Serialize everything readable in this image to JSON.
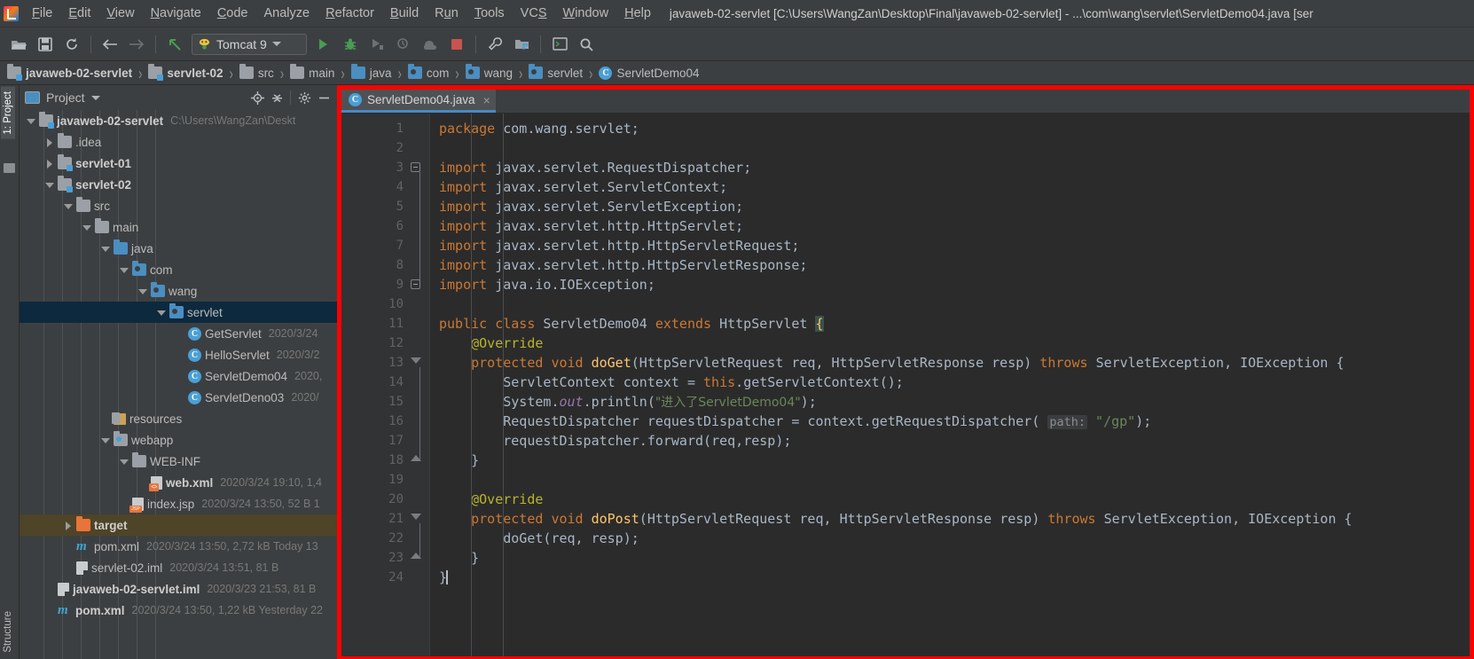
{
  "window": {
    "title": "javaweb-02-servlet [C:\\Users\\WangZan\\Desktop\\Final\\javaweb-02-servlet] - ...\\com\\wang\\servlet\\ServletDemo04.java [ser"
  },
  "menubar": {
    "items": [
      {
        "label": "File",
        "mnemonic": "F"
      },
      {
        "label": "Edit",
        "mnemonic": "E"
      },
      {
        "label": "View",
        "mnemonic": "V"
      },
      {
        "label": "Navigate",
        "mnemonic": "N"
      },
      {
        "label": "Code",
        "mnemonic": "C"
      },
      {
        "label": "Analyze",
        "mnemonic": ""
      },
      {
        "label": "Refactor",
        "mnemonic": "R"
      },
      {
        "label": "Build",
        "mnemonic": "B"
      },
      {
        "label": "Run",
        "mnemonic": "u"
      },
      {
        "label": "Tools",
        "mnemonic": "T"
      },
      {
        "label": "VCS",
        "mnemonic": "S"
      },
      {
        "label": "Window",
        "mnemonic": "W"
      },
      {
        "label": "Help",
        "mnemonic": "H"
      }
    ]
  },
  "toolbar": {
    "run_config": "Tomcat 9",
    "buttons": [
      "open-project-icon",
      "save-all-icon",
      "sync-icon",
      "back-icon",
      "forward-icon",
      "undo-icon",
      "run-icon",
      "debug-icon",
      "run-with-coverage-icon",
      "profile-icon",
      "update-app-icon",
      "stop-icon",
      "settings-wrench-icon",
      "project-structure-icon",
      "terminal-icon",
      "search-everywhere-icon"
    ]
  },
  "breadcrumb": {
    "items": [
      {
        "label": "javaweb-02-servlet",
        "icon": "module-folder-icon",
        "bold": true
      },
      {
        "label": "servlet-02",
        "icon": "module-folder-icon",
        "bold": true
      },
      {
        "label": "src",
        "icon": "folder-icon",
        "bold": false
      },
      {
        "label": "main",
        "icon": "folder-icon",
        "bold": false
      },
      {
        "label": "java",
        "icon": "source-folder-icon",
        "bold": false
      },
      {
        "label": "com",
        "icon": "package-icon",
        "bold": false
      },
      {
        "label": "wang",
        "icon": "package-icon",
        "bold": false
      },
      {
        "label": "servlet",
        "icon": "package-icon",
        "bold": false
      },
      {
        "label": "ServletDemo04",
        "icon": "class-icon",
        "bold": false
      }
    ]
  },
  "tool_windows": {
    "left_top": "1: Project",
    "left_bottom": "Structure"
  },
  "project_panel": {
    "title": "Project",
    "actions": [
      "locate-icon",
      "collapse-all-icon",
      "settings-gear-icon",
      "hide-icon"
    ],
    "tree": [
      {
        "depth": 0,
        "twist": "down",
        "icon": "module-folder-icon",
        "label": "javaweb-02-servlet",
        "bold": true,
        "meta": "C:\\Users\\WangZan\\Deskt"
      },
      {
        "depth": 1,
        "twist": "right",
        "icon": "folder-icon",
        "label": ".idea",
        "bold": false,
        "meta": ""
      },
      {
        "depth": 1,
        "twist": "right",
        "icon": "module-folder-icon",
        "label": "servlet-01",
        "bold": true,
        "meta": ""
      },
      {
        "depth": 1,
        "twist": "down",
        "icon": "module-folder-icon",
        "label": "servlet-02",
        "bold": true,
        "meta": ""
      },
      {
        "depth": 2,
        "twist": "down",
        "icon": "folder-icon",
        "label": "src",
        "bold": false,
        "meta": ""
      },
      {
        "depth": 3,
        "twist": "down",
        "icon": "folder-icon",
        "label": "main",
        "bold": false,
        "meta": ""
      },
      {
        "depth": 4,
        "twist": "down",
        "icon": "source-folder-icon",
        "label": "java",
        "bold": false,
        "meta": ""
      },
      {
        "depth": 5,
        "twist": "down",
        "icon": "package-icon",
        "label": "com",
        "bold": false,
        "meta": ""
      },
      {
        "depth": 6,
        "twist": "down",
        "icon": "package-icon",
        "label": "wang",
        "bold": false,
        "meta": ""
      },
      {
        "depth": 7,
        "twist": "down",
        "icon": "package-icon",
        "label": "servlet",
        "bold": false,
        "meta": "",
        "selected": true
      },
      {
        "depth": 8,
        "twist": "none",
        "icon": "class-icon",
        "label": "GetServlet",
        "bold": false,
        "meta": "2020/3/24"
      },
      {
        "depth": 8,
        "twist": "none",
        "icon": "class-icon",
        "label": "HelloServlet",
        "bold": false,
        "meta": "2020/3/2"
      },
      {
        "depth": 8,
        "twist": "none",
        "icon": "class-icon",
        "label": "ServletDemo04",
        "bold": false,
        "meta": "2020,"
      },
      {
        "depth": 8,
        "twist": "none",
        "icon": "class-icon",
        "label": "ServletDeno03",
        "bold": false,
        "meta": "2020/"
      },
      {
        "depth": 4,
        "twist": "none",
        "icon": "resources-icon",
        "label": "resources",
        "bold": false,
        "meta": ""
      },
      {
        "depth": 4,
        "twist": "down",
        "icon": "webapp-icon",
        "label": "webapp",
        "bold": false,
        "meta": ""
      },
      {
        "depth": 5,
        "twist": "down",
        "icon": "folder-icon",
        "label": "WEB-INF",
        "bold": false,
        "meta": ""
      },
      {
        "depth": 6,
        "twist": "none",
        "icon": "xml-file-icon",
        "label": "web.xml",
        "bold": true,
        "meta": "2020/3/24 19:10, 1,4"
      },
      {
        "depth": 5,
        "twist": "none",
        "icon": "jsp-file-icon",
        "label": "index.jsp",
        "bold": false,
        "meta": "2020/3/24 13:50, 52 B 1"
      },
      {
        "depth": 2,
        "twist": "right",
        "icon": "target-folder-icon",
        "label": "target",
        "bold": true,
        "meta": "",
        "highlight": true
      },
      {
        "depth": 2,
        "twist": "none",
        "icon": "maven-icon",
        "label": "pom.xml",
        "bold": false,
        "meta": "2020/3/24 13:50, 2,72 kB Today 13"
      },
      {
        "depth": 2,
        "twist": "none",
        "icon": "iml-file-icon",
        "label": "servlet-02.iml",
        "bold": false,
        "meta": "2020/3/24 13:51, 81 B"
      },
      {
        "depth": 1,
        "twist": "none",
        "icon": "iml-file-icon",
        "label": "javaweb-02-servlet.iml",
        "bold": true,
        "meta": "2020/3/23 21:53, 81 B"
      },
      {
        "depth": 1,
        "twist": "none",
        "icon": "maven-icon",
        "label": "pom.xml",
        "bold": true,
        "meta": "2020/3/24 13:50, 1,22 kB Yesterday 22"
      }
    ]
  },
  "editor": {
    "tab": {
      "label": "ServletDemo04.java",
      "icon": "java-class-icon",
      "close": "×"
    },
    "gutter_markers": [
      {
        "line": 13,
        "icon": "overriding-method-icon"
      },
      {
        "line": 21,
        "icon": "overriding-method-icon"
      }
    ],
    "lines": [
      {
        "n": 1,
        "text": "package com.wang.servlet;"
      },
      {
        "n": 2,
        "text": ""
      },
      {
        "n": 3,
        "text": "import javax.servlet.RequestDispatcher;"
      },
      {
        "n": 4,
        "text": "import javax.servlet.ServletContext;"
      },
      {
        "n": 5,
        "text": "import javax.servlet.ServletException;"
      },
      {
        "n": 6,
        "text": "import javax.servlet.http.HttpServlet;"
      },
      {
        "n": 7,
        "text": "import javax.servlet.http.HttpServletRequest;"
      },
      {
        "n": 8,
        "text": "import javax.servlet.http.HttpServletResponse;"
      },
      {
        "n": 9,
        "text": "import java.io.IOException;"
      },
      {
        "n": 10,
        "text": ""
      },
      {
        "n": 11,
        "text": "public class ServletDemo04 extends HttpServlet {"
      },
      {
        "n": 12,
        "text": "    @Override"
      },
      {
        "n": 13,
        "text": "    protected void doGet(HttpServletRequest req, HttpServletResponse resp) throws ServletException, IOException {"
      },
      {
        "n": 14,
        "text": "        ServletContext context = this.getServletContext();"
      },
      {
        "n": 15,
        "text": "        System.out.println(\"进入了ServletDemo04\");"
      },
      {
        "n": 16,
        "text": "        RequestDispatcher requestDispatcher = context.getRequestDispatcher( path: \"/gp\");"
      },
      {
        "n": 17,
        "text": "        requestDispatcher.forward(req,resp);"
      },
      {
        "n": 18,
        "text": "    }"
      },
      {
        "n": 19,
        "text": ""
      },
      {
        "n": 20,
        "text": "    @Override"
      },
      {
        "n": 21,
        "text": "    protected void doPost(HttpServletRequest req, HttpServletResponse resp) throws ServletException, IOException {"
      },
      {
        "n": 22,
        "text": "        doGet(req, resp);"
      },
      {
        "n": 23,
        "text": "    }"
      },
      {
        "n": 24,
        "text": "}"
      }
    ],
    "parameter_hint": "path:",
    "string_literals": [
      "进入了ServletDemo04",
      "/gp"
    ]
  },
  "annotation": {
    "highlight_color": "#fe0000",
    "description": "red-rectangle-highlight-around-editor"
  },
  "colors": {
    "background": "#3c3f41",
    "editor_background": "#2b2b2b",
    "gutter_background": "#313335",
    "selection": "#0d293e",
    "accent": "#4a88c7",
    "keyword": "#cc7832",
    "string": "#6a8759",
    "annotation": "#bbb529",
    "method": "#ffc66d",
    "plain_text": "#a9b7c6",
    "field_italic": "#9876aa"
  }
}
